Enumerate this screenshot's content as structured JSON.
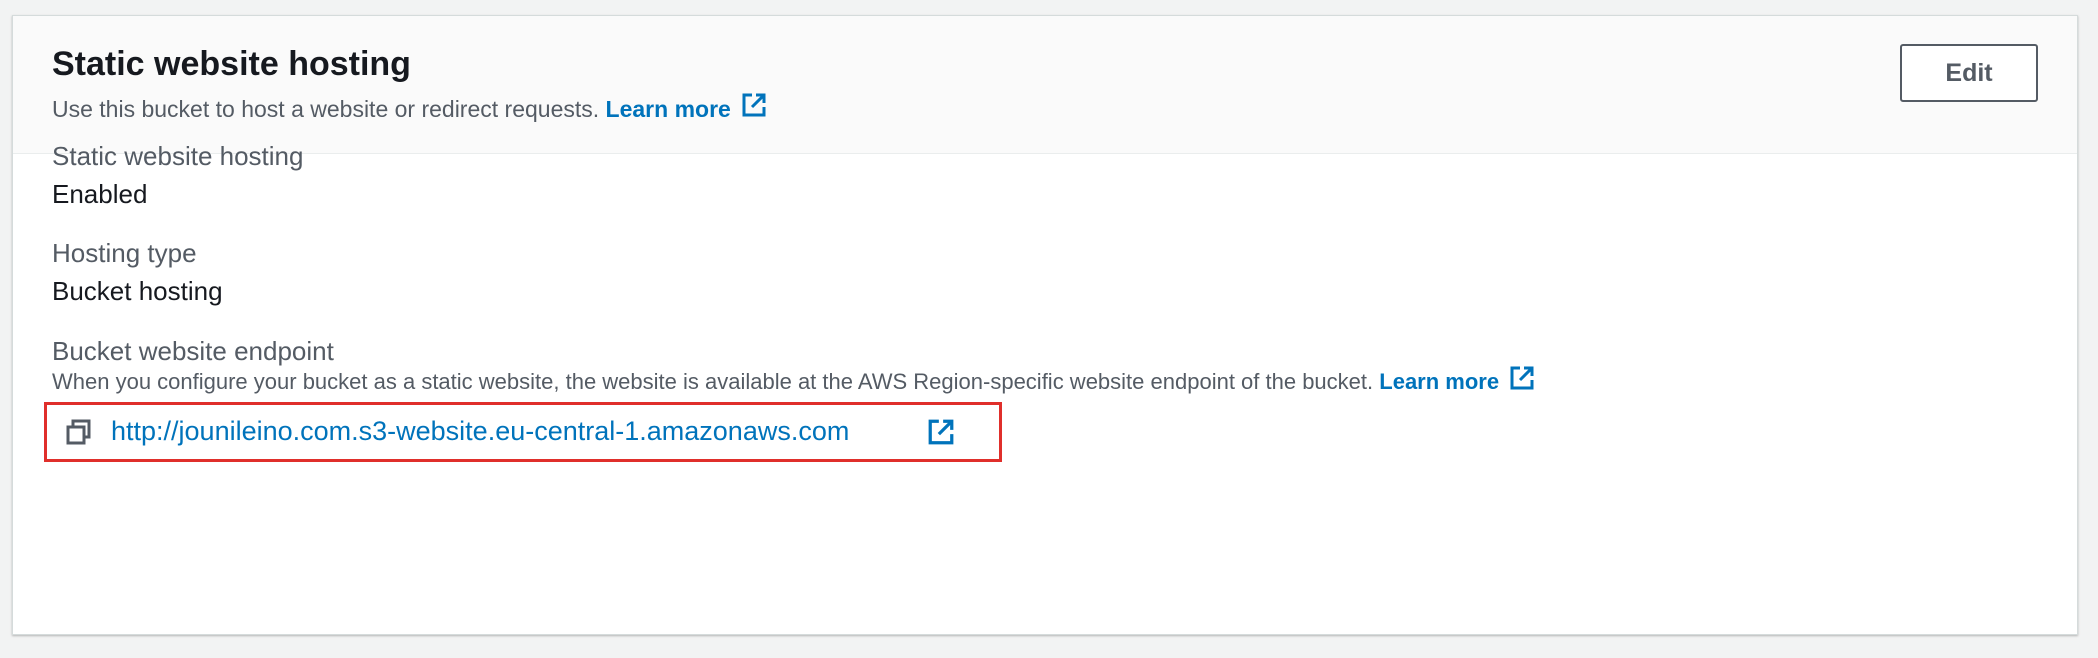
{
  "header": {
    "title": "Static website hosting",
    "description": "Use this bucket to host a website or redirect requests.",
    "learn_more": "Learn more",
    "edit_label": "Edit"
  },
  "fields": {
    "hosting_label": "Static website hosting",
    "hosting_value": "Enabled",
    "type_label": "Hosting type",
    "type_value": "Bucket hosting",
    "endpoint_label": "Bucket website endpoint",
    "endpoint_description": "When you configure your bucket as a static website, the website is available at the AWS Region-specific website endpoint of the bucket.",
    "endpoint_learn_more": "Learn more",
    "endpoint_url": "http://jounileino.com.s3-website.eu-central-1.amazonaws.com"
  },
  "icons": {
    "external_link": "external-link-icon",
    "copy": "copy-icon"
  },
  "colors": {
    "link": "#0073bb",
    "highlight_border": "#e02f2b",
    "heading": "#16191f",
    "secondary_text": "#545b64"
  }
}
